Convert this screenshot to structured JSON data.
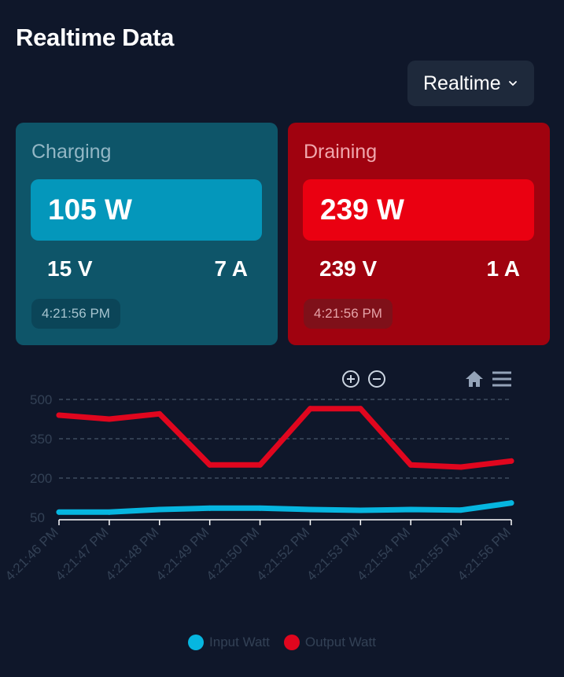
{
  "page": {
    "title": "Realtime Data"
  },
  "mode_select": {
    "value": "Realtime"
  },
  "cards": {
    "charging": {
      "label": "Charging",
      "power": "105 W",
      "voltage": "15 V",
      "current": "7 A",
      "time": "4:21:56 PM"
    },
    "draining": {
      "label": "Draining",
      "power": "239 W",
      "voltage": "239 V",
      "current": "1 A",
      "time": "4:21:56 PM"
    }
  },
  "toolbar": {
    "zoom_in_icon": "zoom-in-icon",
    "zoom_out_icon": "zoom-out-icon",
    "home_icon": "home-icon",
    "menu_icon": "menu-icon"
  },
  "colors": {
    "input": "#06b6e0",
    "output": "#e0061e",
    "grid": "#475569",
    "axis_text": "#334155"
  },
  "chart_data": {
    "type": "line",
    "categories": [
      "4:21:46 PM",
      "4:21:47 PM",
      "4:21:48 PM",
      "4:21:49 PM",
      "4:21:50 PM",
      "4:21:52 PM",
      "4:21:53 PM",
      "4:21:54 PM",
      "4:21:55 PM",
      "4:21:56 PM"
    ],
    "y_ticks": [
      "500",
      "350",
      "200",
      "50"
    ],
    "ylim": [
      50,
      500
    ],
    "grid": true,
    "legend_position": "bottom",
    "series": [
      {
        "name": "Input Watt",
        "color": "#06b6e0",
        "values": [
          70,
          70,
          80,
          85,
          85,
          80,
          77,
          80,
          78,
          105
        ]
      },
      {
        "name": "Output Watt",
        "color": "#e0061e",
        "values": [
          440,
          425,
          445,
          250,
          250,
          465,
          465,
          250,
          242,
          265
        ]
      }
    ]
  }
}
